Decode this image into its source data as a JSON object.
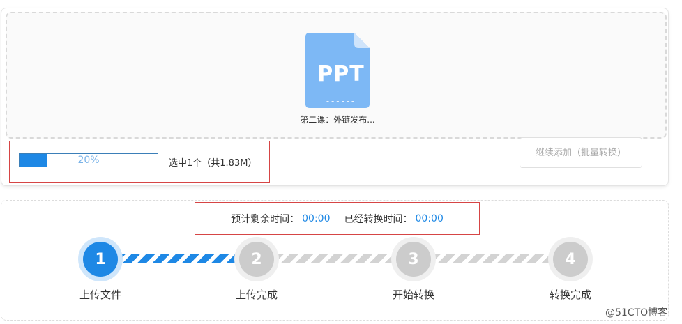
{
  "file": {
    "type_label": "PPT",
    "dash_decoration": "------",
    "name": "第二课：外链发布...",
    "icon_color": "#7db8f5"
  },
  "progress": {
    "value": 0.2,
    "percent_label": "20%",
    "selection_info": "选中1个（共1.83M）"
  },
  "add_more_button": {
    "label": "继续添加（批量转换）"
  },
  "timers": {
    "remaining_label": "预计剩余时间：",
    "remaining_value": "00:00",
    "elapsed_label": "已经转换时间：",
    "elapsed_value": "00:00"
  },
  "steps": [
    {
      "number": "1",
      "label": "上传文件",
      "state": "active"
    },
    {
      "number": "2",
      "label": "上传完成",
      "state": "inactive"
    },
    {
      "number": "3",
      "label": "开始转换",
      "state": "inactive"
    },
    {
      "number": "4",
      "label": "转换完成",
      "state": "inactive"
    }
  ],
  "watermark": "@51CTO博客",
  "colors": {
    "accent": "#1e88e5",
    "inactive": "#cccccc",
    "highlight_border": "#d64545"
  }
}
